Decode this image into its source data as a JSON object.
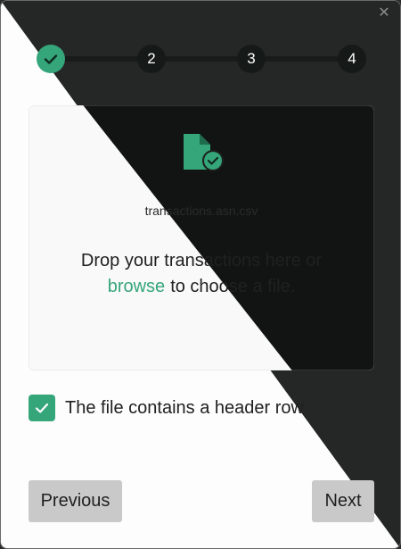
{
  "dialog": {
    "close_icon": "close-icon"
  },
  "stepper": {
    "steps": [
      {
        "label": "",
        "state": "done",
        "icon": "check-icon"
      },
      {
        "label": "2",
        "state": "pending"
      },
      {
        "label": "3",
        "state": "pending"
      },
      {
        "label": "4",
        "state": "pending"
      }
    ]
  },
  "dropzone": {
    "file_icon": "csv-file-check-icon",
    "file_name": "transactions.asn.csv",
    "prompt_before": "Drop your transactions here or",
    "browse_link": "browse",
    "prompt_after": "to choose a file."
  },
  "options": {
    "header_row_checked": true,
    "header_row_label": "The file contains a header row"
  },
  "footer": {
    "previous_label": "Previous",
    "next_label": "Next"
  },
  "colors": {
    "accent": "#35a57a",
    "dark_bg": "#252726",
    "light_bg": "#fdfdfd"
  }
}
